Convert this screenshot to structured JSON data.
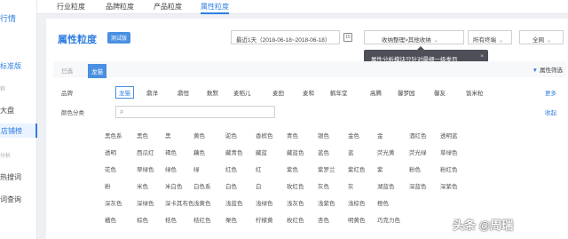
{
  "sidebar": {
    "brand": "行情",
    "version": "标准版",
    "items": [
      "称",
      "大盘",
      "店铺榜",
      "分析",
      "热搜词",
      "词查询"
    ]
  },
  "tabs": [
    "行业粒度",
    "品牌粒度",
    "产品粒度",
    "属性粒度"
  ],
  "header": {
    "title": "属性粒度",
    "trial_badge": "测试版",
    "date_range": "最近1天（2018-06-18~2018-06-18）",
    "calendar_label": "15",
    "category": "收纳整理>其他收纳",
    "terminal": "所有终端",
    "network": "全网"
  },
  "tooltip": {
    "text": "属性分析模块只针对最细一级类目",
    "close": "×"
  },
  "selection": {
    "label": "已选",
    "chip": "龙猫",
    "filter": "属性筛选"
  },
  "brand_row": {
    "label": "品牌",
    "more": "更多",
    "items": [
      "龙猫",
      "鼎洋",
      "鼎恒",
      "数默",
      "麦稻儿",
      "麦田",
      "麦和",
      "鹤年堂",
      "高腾",
      "馨梦园",
      "馨友",
      "饭米粒"
    ]
  },
  "color_row": {
    "label": "颜色分类",
    "collapse": "收起",
    "search_placeholder": "",
    "rows": [
      [
        "黑色系",
        "黑色",
        "黑",
        "黄色",
        "驼色",
        "香槟色",
        "青色",
        "银色",
        "金色",
        "金",
        "酒红色",
        "透明蓝"
      ],
      [
        "透明",
        "西瓜红",
        "褐色",
        "藕色",
        "藏青色",
        "藏蓝",
        "藏蓝色",
        "蓝色",
        "蓝",
        "荧光黄",
        "荧光绿",
        "草绿色"
      ],
      [
        "花色",
        "翠绿色",
        "绿色",
        "绿",
        "红色",
        "红",
        "紫色",
        "紫罗兰",
        "紫红色",
        "紫",
        "粉色",
        "粉红色"
      ],
      [
        "粉",
        "米色",
        "米白色",
        "白色系",
        "白色",
        "白",
        "玫红色",
        "灰色",
        "灰",
        "湖蓝色",
        "深蓝色",
        "深紫色"
      ],
      [
        "深灰色",
        "深绿色",
        "深卡其布色",
        "浅黄色",
        "浅蓝色",
        "浅绿色",
        "浅灰色",
        "浅紫色",
        "浅棕色",
        "橙色"
      ],
      [
        "橘色",
        "棕色",
        "桔色",
        "桔红色",
        "栗色",
        "柠檬黄",
        "枚红色",
        "杏色",
        "明黄色",
        "巧克力色"
      ]
    ]
  },
  "watermark": "头条 @周瑞",
  "colors": {
    "accent": "#2f7de1",
    "badge": "#4a90e2",
    "tooltip_bg": "#4d5058"
  }
}
